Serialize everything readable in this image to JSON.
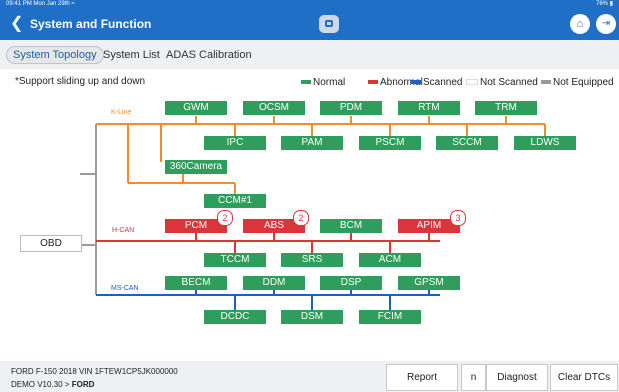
{
  "status_bar": {
    "time": "09:41",
    "ampm": "PM",
    "date": "Mon Jan 29th",
    "battery": "76%"
  },
  "header": {
    "title": "System and Function"
  },
  "tabs": [
    "System Topology",
    "System List",
    "ADAS Calibration"
  ],
  "support_text": "*Support sliding up and down",
  "legend": [
    {
      "label": "Normal",
      "color": "#2f9e5c"
    },
    {
      "label": "Abnormal",
      "color": "#d9353b"
    },
    {
      "label": "Scanned",
      "color": "#1f5fbf"
    },
    {
      "label": "Not Scanned",
      "color": "#ffffff"
    },
    {
      "label": "Not Equipped",
      "color": "#9a9a9a"
    }
  ],
  "buses": {
    "kline": "K-Line",
    "hcan": "H-CAN",
    "mscan": "MS-CAN"
  },
  "obd": "OBD",
  "ecus": {
    "gwm": "GWM",
    "ocsm": "OCSM",
    "pdm": "PDM",
    "rtm": "RTM",
    "trm": "TRM",
    "ipc": "IPC",
    "pam": "PAM",
    "pscm": "PSCM",
    "sccm": "SCCM",
    "ldws": "LDWS",
    "cam360": "360Camera",
    "ccm1": "CCM#1",
    "pcm": "PCM",
    "abs": "ABS",
    "bcm": "BCM",
    "apim": "APIM",
    "tccm": "TCCM",
    "srs": "SRS",
    "acm": "ACM",
    "becm": "BECM",
    "ddm": "DDM",
    "dsp": "DSP",
    "gpsm": "GPSM",
    "dcdc": "DCDC",
    "dsm": "DSM",
    "fcim": "FCIM"
  },
  "badges": {
    "pcm": "2",
    "abs": "2",
    "apim": "3"
  },
  "footer": {
    "vehicle": "FORD  F-150  2018  VIN  1FTEW1CP5JK000000",
    "path_prefix": "DEMO V10.30 > ",
    "path_brand": "FORD",
    "report": "Report",
    "n": "n",
    "diagnose": "Diagnost",
    "clear": "Clear DTCs"
  }
}
